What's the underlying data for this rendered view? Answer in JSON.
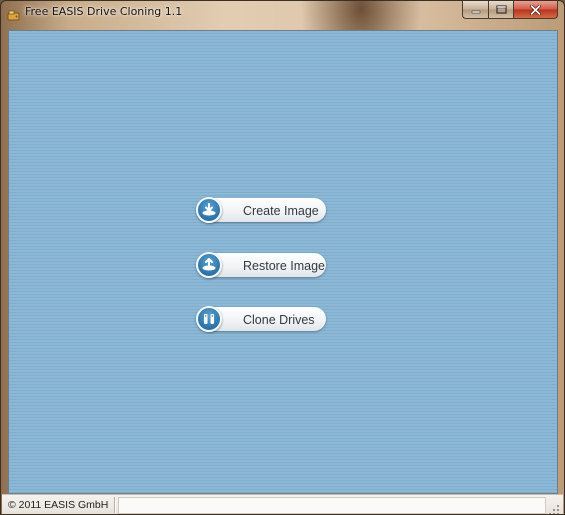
{
  "window": {
    "title": "Free EASIS Drive Cloning 1.1",
    "app_icon": "drive-clone-app-icon",
    "caption_buttons": [
      "minimize-icon",
      "maximize-icon",
      "close-icon"
    ]
  },
  "main": {
    "background_color": "#8ab6d3",
    "actions": [
      {
        "label": "Create Image",
        "icon": "create-image-icon"
      },
      {
        "label": "Restore Image",
        "icon": "restore-image-icon"
      },
      {
        "label": "Clone Drives",
        "icon": "clone-drives-icon"
      }
    ]
  },
  "statusbar": {
    "copyright": "© 2011 EASIS GmbH",
    "panel_text": ""
  },
  "colors": {
    "accent": "#2d72a6",
    "close_button": "#c94a32"
  }
}
